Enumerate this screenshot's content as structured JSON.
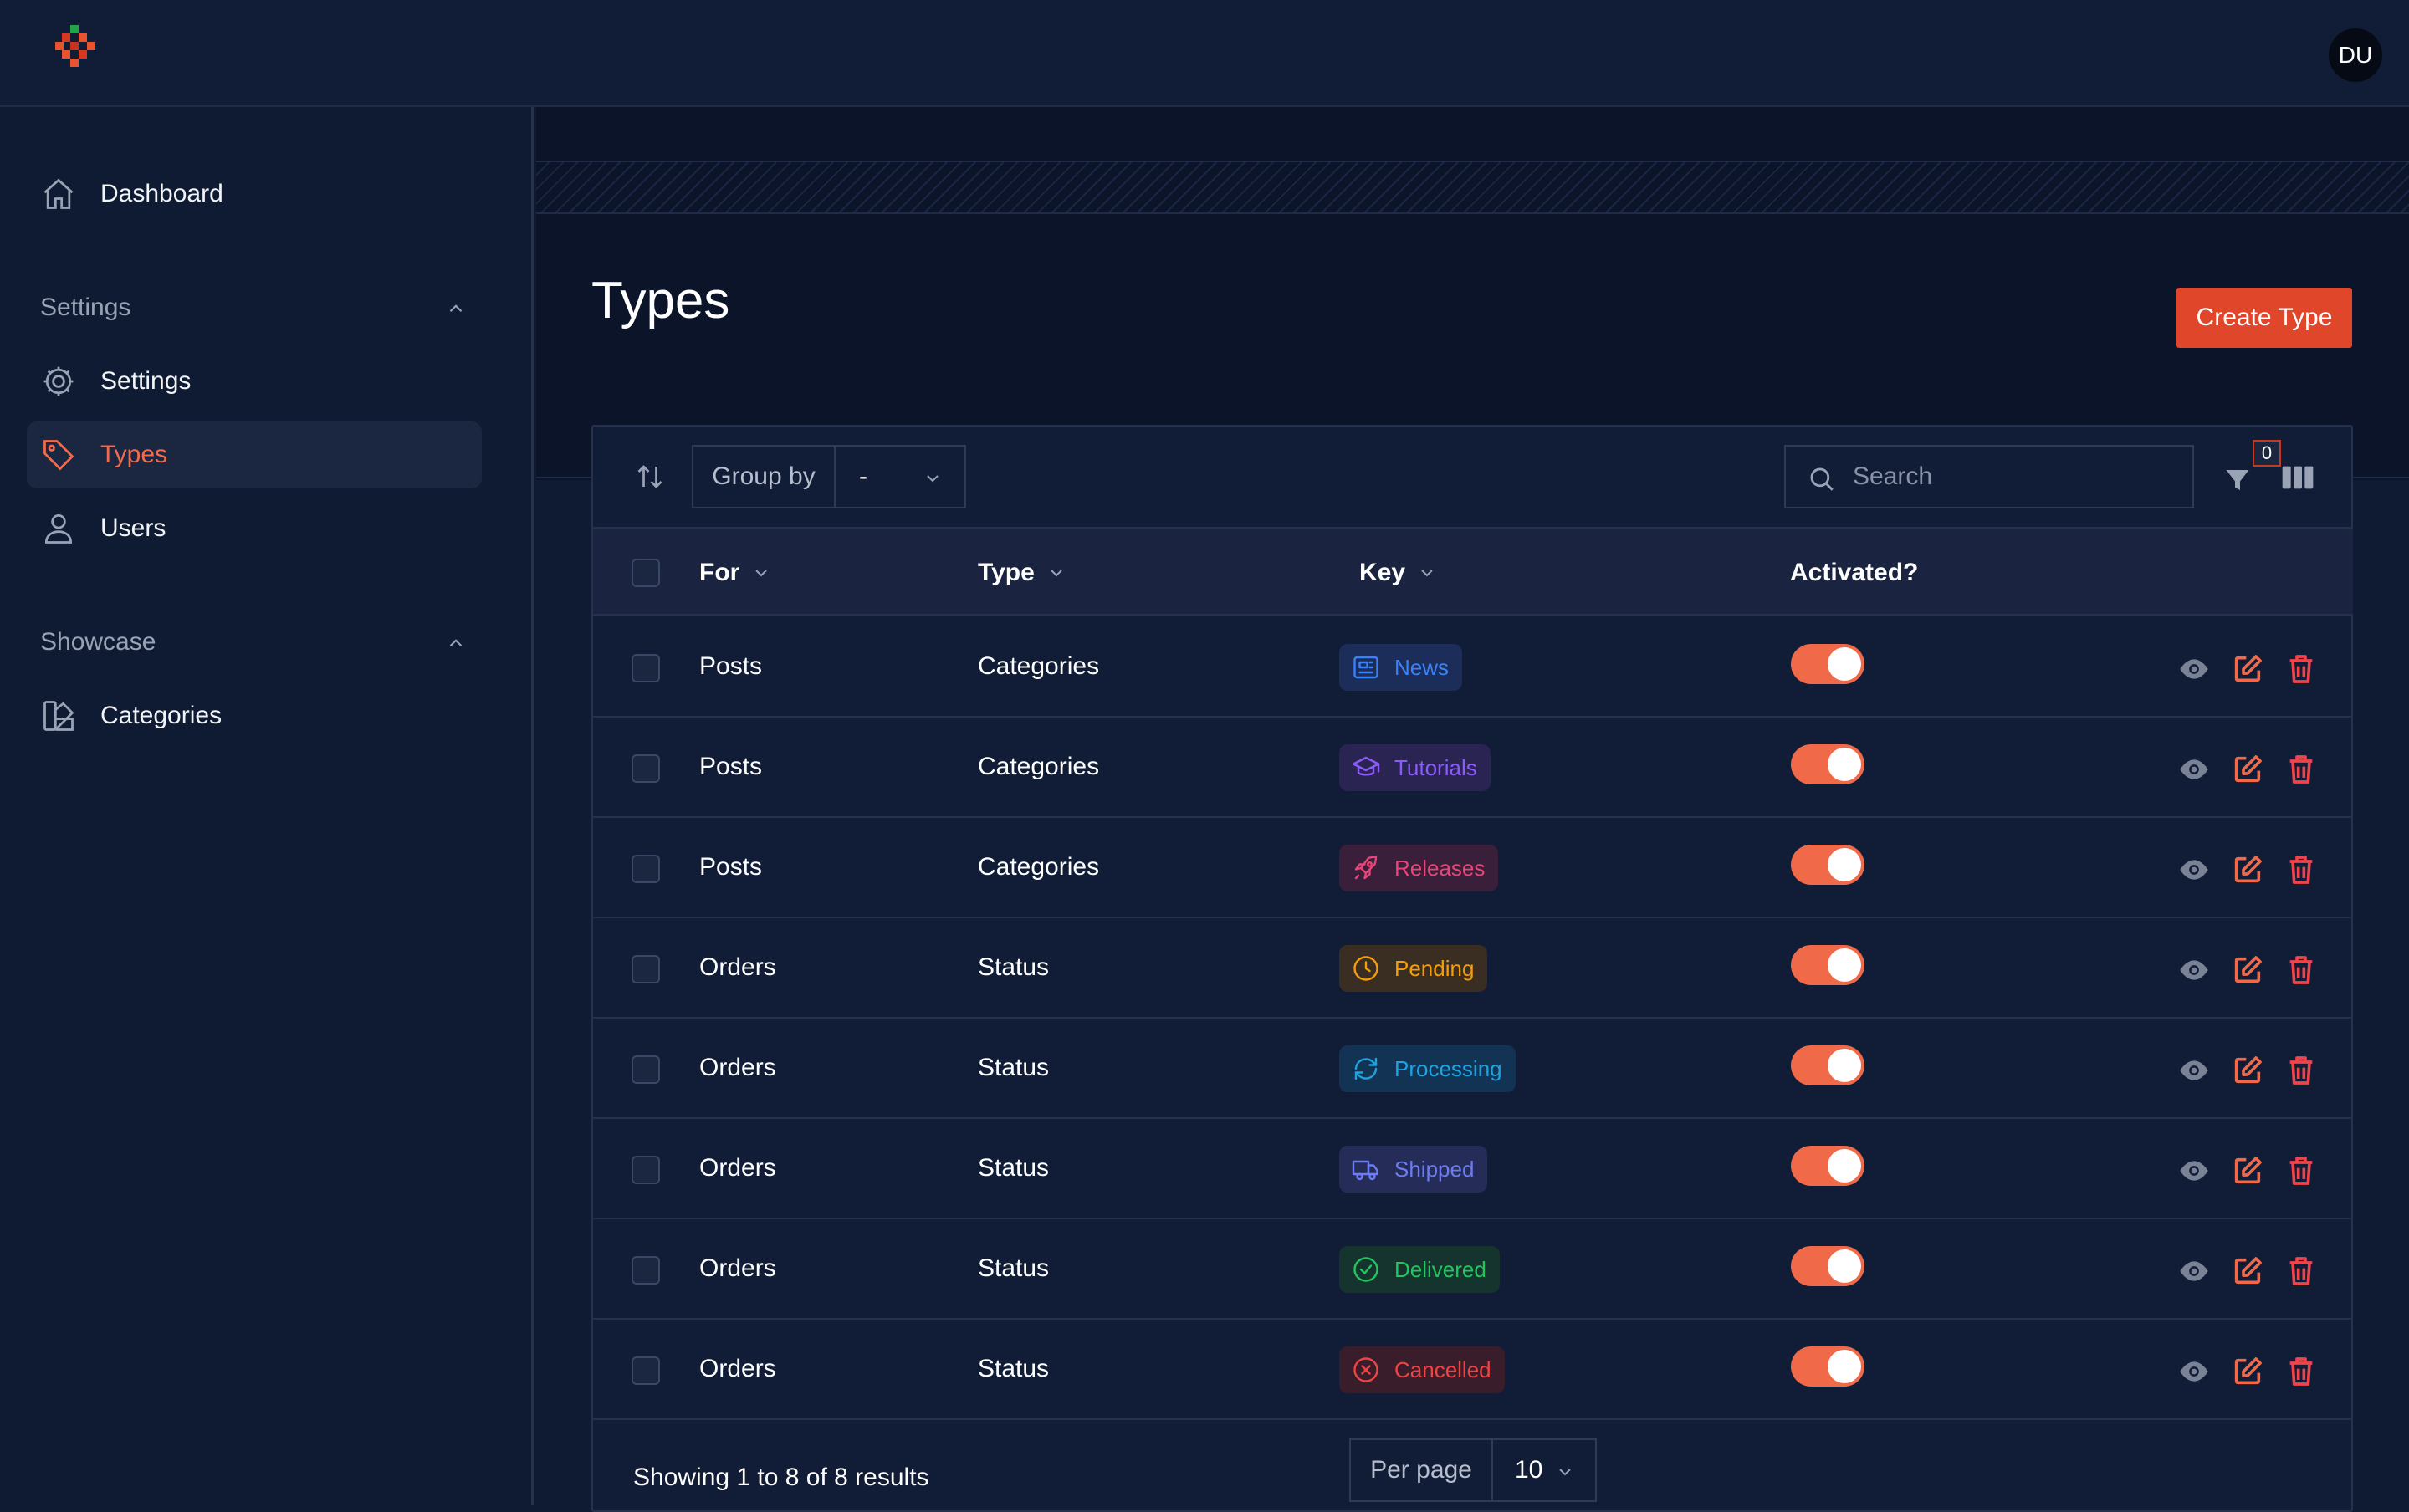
{
  "header": {
    "avatar_initials": "DU"
  },
  "sidebar": {
    "dashboard": {
      "label": "Dashboard",
      "icon": "home-icon"
    },
    "groups": [
      {
        "title": "Settings",
        "expanded": true
      },
      {
        "title": "Showcase",
        "expanded": true
      }
    ],
    "settings_items": [
      {
        "label": "Settings",
        "icon": "gear-icon"
      },
      {
        "label": "Types",
        "icon": "tag-icon",
        "active": true
      },
      {
        "label": "Users",
        "icon": "user-icon"
      }
    ],
    "showcase_items": [
      {
        "label": "Categories",
        "icon": "swatch-icon"
      }
    ]
  },
  "page": {
    "title": "Types",
    "create_label": "Create Type"
  },
  "toolbar": {
    "group_by_label": "Group by",
    "group_by_value": "-",
    "search_placeholder": "Search",
    "filter_count": "0"
  },
  "table": {
    "columns": [
      "For",
      "Type",
      "Key",
      "Activated?"
    ],
    "rows": [
      {
        "for": "Posts",
        "type": "Categories",
        "key": "News",
        "key_icon": "newspaper-icon",
        "key_color": "#3b82f6",
        "key_bg": "#1c2d5a",
        "activated": true
      },
      {
        "for": "Posts",
        "type": "Categories",
        "key": "Tutorials",
        "key_icon": "graduation-cap-icon",
        "key_color": "#8b5cf6",
        "key_bg": "#2a2452",
        "activated": true
      },
      {
        "for": "Posts",
        "type": "Categories",
        "key": "Releases",
        "key_icon": "rocket-icon",
        "key_color": "#e8457a",
        "key_bg": "#3a1f3a",
        "activated": true
      },
      {
        "for": "Orders",
        "type": "Status",
        "key": "Pending",
        "key_icon": "clock-icon",
        "key_color": "#f59e0b",
        "key_bg": "#3a2d22",
        "activated": true
      },
      {
        "for": "Orders",
        "type": "Status",
        "key": "Processing",
        "key_icon": "refresh-icon",
        "key_color": "#1fa3e0",
        "key_bg": "#123353",
        "activated": true
      },
      {
        "for": "Orders",
        "type": "Status",
        "key": "Shipped",
        "key_icon": "truck-icon",
        "key_color": "#6d7cf2",
        "key_bg": "#252c57",
        "activated": true
      },
      {
        "for": "Orders",
        "type": "Status",
        "key": "Delivered",
        "key_icon": "check-circle-icon",
        "key_color": "#22c55e",
        "key_bg": "#15342e",
        "activated": true
      },
      {
        "for": "Orders",
        "type": "Status",
        "key": "Cancelled",
        "key_icon": "x-circle-icon",
        "key_color": "#ef4444",
        "key_bg": "#3a1d2a",
        "activated": true
      }
    ]
  },
  "footer": {
    "results_text": "Showing 1 to 8 of 8 results",
    "per_page_label": "Per page",
    "per_page_value": "10"
  },
  "colors": {
    "accent": "#f06a4a",
    "primary_button": "#e0462a",
    "background": "#0f1a33"
  }
}
